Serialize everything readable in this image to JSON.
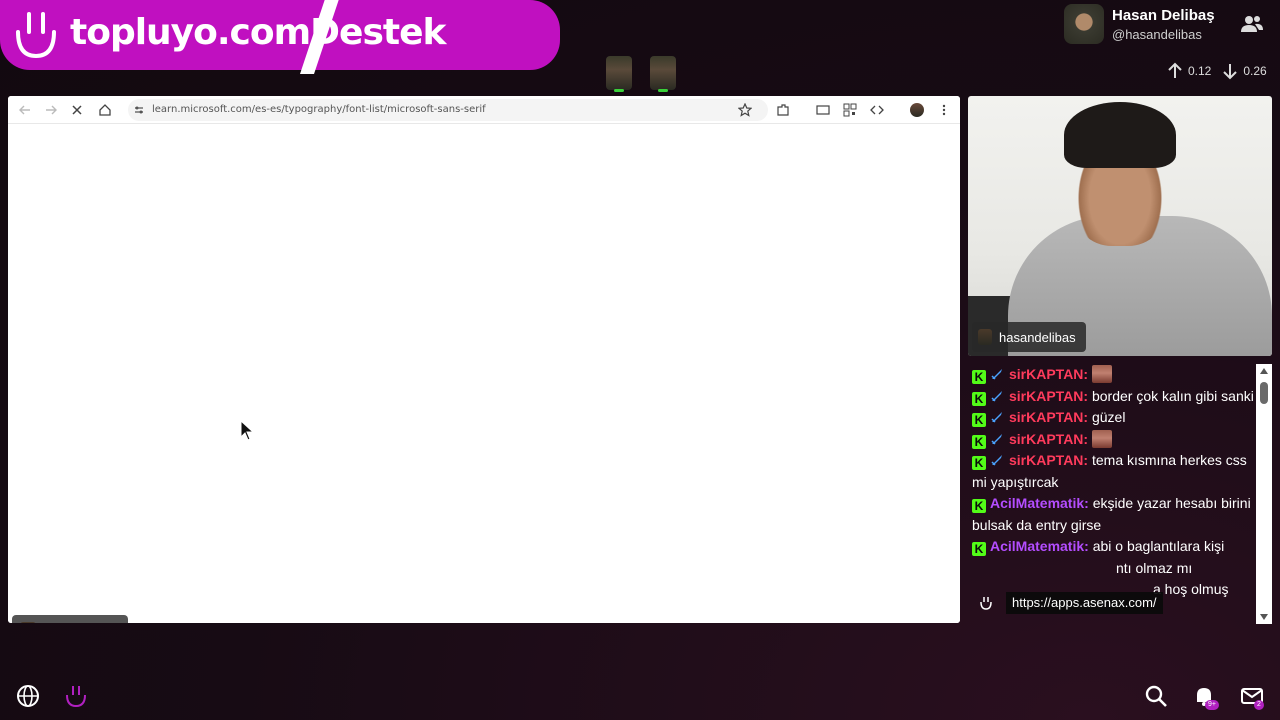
{
  "banner": {
    "text": "topluyo.com/Destek",
    "text_visible_part1": "topluyo.co",
    "text_visible_part2": "Destek",
    "text_hidden_m": "m",
    "color": "#c010c0"
  },
  "profile": {
    "name": "Hasan Delibaş",
    "handle": "@hasandelibas"
  },
  "netstats": {
    "upload": "0.12",
    "download": "0.26"
  },
  "browser": {
    "url": "learn.microsoft.com/es-es/typography/font-list/microsoft-sans-serif",
    "loading": true
  },
  "screen_name_tag": "hasandelibas",
  "webcam_label": "hasandelibas",
  "chat": {
    "messages": [
      {
        "user": "sirKAPTAN",
        "text": "",
        "emote": true,
        "color": "#ff3b5c"
      },
      {
        "user": "sirKAPTAN",
        "text": "border çok kalın gibi sanki",
        "emote": false,
        "color": "#ff3b5c"
      },
      {
        "user": "sirKAPTAN",
        "text": "güzel",
        "emote": false,
        "color": "#ff3b5c"
      },
      {
        "user": "sirKAPTAN",
        "text": "",
        "emote": true,
        "color": "#ff3b5c"
      },
      {
        "user": "sirKAPTAN",
        "text": "tema kısmına herkes css mi yapıştırcak",
        "emote": false,
        "color": "#ff3b5c"
      },
      {
        "user": "AcilMatematik",
        "text": "ekşide yazar hesabı birini bulsak da entry girse",
        "emote": false,
        "color": "#b44dff"
      },
      {
        "user": "AcilMatematik",
        "text": "abi o baglantılara kişi",
        "emote": false,
        "color": "#b44dff"
      }
    ],
    "partial_text_1": "ntı olmaz mı",
    "partial_text_2": "a hoş olmuş",
    "link_overlay": "https://apps.asenax.com/"
  },
  "bottom": {
    "notification_count": "9+",
    "mail_count": "2"
  },
  "colors": {
    "kick_green": "#53fc18",
    "accent_purple": "#b020c0"
  }
}
